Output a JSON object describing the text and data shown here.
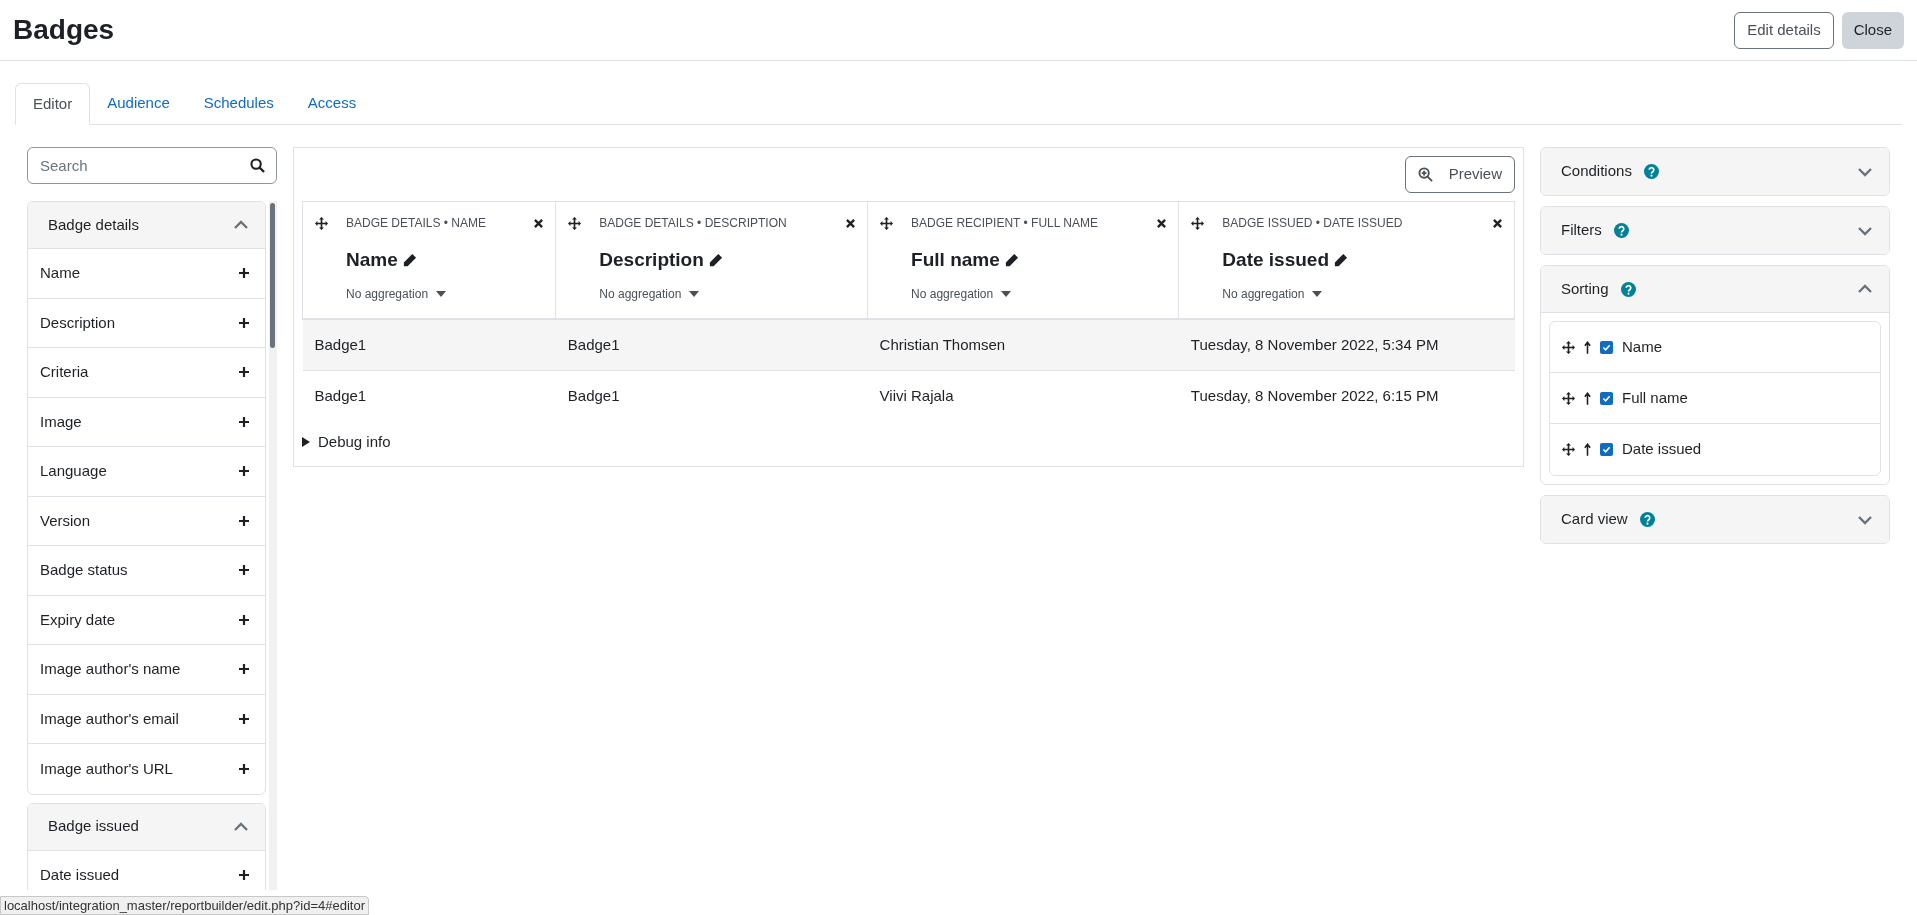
{
  "page": {
    "title": "Badges",
    "buttons": [
      {
        "label": "Edit details",
        "kind": "outline"
      },
      {
        "label": "Close",
        "kind": "secondary"
      }
    ]
  },
  "tabs": [
    {
      "label": "Editor",
      "selected": true
    },
    {
      "label": "Audience",
      "selected": false
    },
    {
      "label": "Schedules",
      "selected": false
    },
    {
      "label": "Access",
      "selected": false
    }
  ],
  "sidebar": {
    "search": {
      "placeholder": "Search"
    },
    "sections": [
      {
        "title": "Badge details",
        "expanded": true,
        "items": [
          "Name",
          "Description",
          "Criteria",
          "Image",
          "Language",
          "Version",
          "Badge status",
          "Expiry date",
          "Image author's name",
          "Image author's email",
          "Image author's URL"
        ]
      },
      {
        "title": "Badge issued",
        "expanded": true,
        "items": [
          "Date issued"
        ]
      }
    ]
  },
  "report": {
    "preview_button": "Preview",
    "columns": [
      {
        "source": "BADGE DETAILS • NAME",
        "title": "Name",
        "aggregation": "No aggregation"
      },
      {
        "source": "BADGE DETAILS • DESCRIPTION",
        "title": "Description",
        "aggregation": "No aggregation"
      },
      {
        "source": "BADGE RECIPIENT • FULL NAME",
        "title": "Full name",
        "aggregation": "No aggregation"
      },
      {
        "source": "BADGE ISSUED • DATE ISSUED",
        "title": "Date issued",
        "aggregation": "No aggregation"
      }
    ],
    "rows": [
      [
        "Badge1",
        "Badge1",
        "Christian Thomsen",
        "Tuesday, 8 November 2022, 5:34 PM"
      ],
      [
        "Badge1",
        "Badge1",
        "Viivi Rajala",
        "Tuesday, 8 November 2022, 6:15 PM"
      ]
    ],
    "debug": {
      "label": "Debug info",
      "expanded": false
    }
  },
  "settings": [
    {
      "title": "Conditions",
      "expanded": false
    },
    {
      "title": "Filters",
      "expanded": false
    },
    {
      "title": "Sorting",
      "expanded": true,
      "items": [
        {
          "label": "Name",
          "checked": true
        },
        {
          "label": "Full name",
          "checked": true
        },
        {
          "label": "Date issued",
          "checked": true
        }
      ]
    },
    {
      "title": "Card view",
      "expanded": false
    }
  ],
  "status_bar": {
    "url": "localhost/integration_master/reportbuilder/edit.php?id=4#editor"
  }
}
